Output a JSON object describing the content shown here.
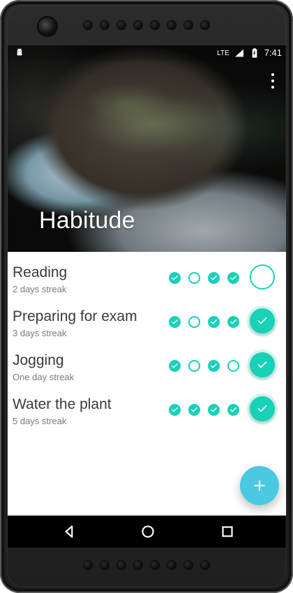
{
  "device": {
    "status_bar": {
      "network": "LTE",
      "time": "7:41",
      "icons": [
        "android-icon",
        "signal-icon",
        "battery-charging-icon"
      ]
    },
    "nav_bar": {
      "icons": [
        "back-icon",
        "home-icon",
        "recents-icon"
      ]
    }
  },
  "app": {
    "title": "Habitude",
    "accent_color": "#18d1b6",
    "fab_color": "#4ac9e1",
    "menu_icon": "overflow-menu-icon",
    "fab_icon": "plus-icon"
  },
  "habits": [
    {
      "name": "Reading",
      "streak": "2 days streak",
      "history": [
        "done",
        "empty",
        "done",
        "done"
      ],
      "today": "empty"
    },
    {
      "name": "Preparing for exam",
      "streak": "3 days streak",
      "history": [
        "done",
        "empty",
        "done",
        "done"
      ],
      "today": "done"
    },
    {
      "name": "Jogging",
      "streak": "One day streak",
      "history": [
        "done",
        "empty",
        "done",
        "empty"
      ],
      "today": "done"
    },
    {
      "name": "Water the plant",
      "streak": "5 days streak",
      "history": [
        "done",
        "done",
        "done",
        "done"
      ],
      "today": "done"
    }
  ]
}
